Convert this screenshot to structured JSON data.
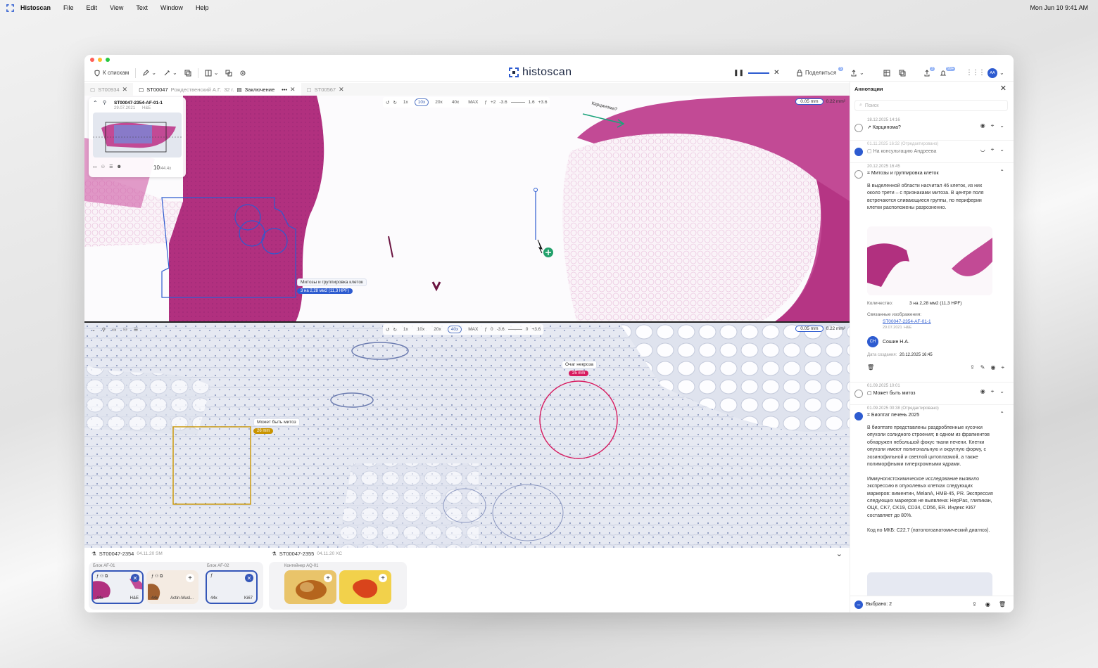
{
  "menubar": {
    "app": "Histoscan",
    "items": [
      "File",
      "Edit",
      "View",
      "Text",
      "Window",
      "Help"
    ],
    "clock": "Mon Jun 10  9:41 AM"
  },
  "toolbar": {
    "back_label": "К спискам",
    "brand": "histoscan",
    "share_label": "Поделиться",
    "share_badge": "5",
    "upload_badge": "3",
    "notif_badge": "99+",
    "avatar": "АА"
  },
  "tabs": [
    {
      "label": "ST00934"
    },
    {
      "label": "ST00047",
      "sub": "Рождественский А.Г.",
      "age": "32 г.",
      "extra": "Заключение"
    },
    {
      "label": "ST00567"
    }
  ],
  "viewer": {
    "zoom_levels": [
      "1x",
      "10x",
      "20x",
      "40x",
      "MAX"
    ],
    "top_selected": "10x",
    "bottom_selected": "40x",
    "top_vals": [
      "+2",
      "-3.6",
      "1.6",
      "+3.6"
    ],
    "bottom_vals": [
      "0",
      "-3.6",
      "0",
      "+3.6"
    ],
    "scale_len": "0.05 mm",
    "scale_area": "0.22 mm²"
  },
  "minimap": {
    "title": "ST00047-2354-AF-01-1",
    "date": "29.07.2021",
    "stain": "H&E",
    "zoom": "10",
    "zoom_max": "/44.4x"
  },
  "annotations_on_slide": {
    "mitosis_label": "Митозы и группировка клеток",
    "mitosis_pill": "3 на 2,28 мм2 (11,3 HPF)",
    "carcinoma_label": "Карцинома?",
    "necrosis_label": "Очаг некроза",
    "necrosis_pill": "25 mm",
    "mitoz_label": "Может быть митоз",
    "mitoz_pill": "26 mm"
  },
  "bottombar": {
    "case1": "ST00047-2354",
    "case1_meta": "04.11.20  SM",
    "case2": "ST00047-2355",
    "case2_meta": "04.11.20  XC",
    "block1": "Блок AF-01",
    "block2": "Блок AF-02",
    "container": "Контейнер AQ-01",
    "thumbs": [
      {
        "tl": "44x",
        "tr": "H&E"
      },
      {
        "tl": "44x",
        "tr": "Actin-Musl..."
      },
      {
        "tl": "44x",
        "tr": "Ki67"
      }
    ]
  },
  "panel": {
    "title": "Аннотации",
    "search_placeholder": "Поиск",
    "items": [
      {
        "date": "18.12.2025 14:16",
        "title": "Карцинома?"
      },
      {
        "date": "01.11.2025 16:32 (Отредактировано)",
        "title": "На консультацию Андреева"
      },
      {
        "date": "20.12.2025 16:45",
        "title": "Митозы и группировка клеток",
        "body": "В выделенной области насчитал 46 клеток, из них около трети – с признаками митоза. В центре поля встречаются сливающиеся группы, по периферии клетки расположены разрозненно.",
        "count_label": "Количество:",
        "count_value": "3 на 2,28 мм2 (11,3 HPF)",
        "linked_label": "Связанные изображения:",
        "linked_link": "ST00047-2354-AF-01-1",
        "linked_date": "29.07.2021",
        "linked_stain": "H&E",
        "author_initials": "СН",
        "author": "Сошин Н.А.",
        "created_label": "Дата создания:",
        "created_value": "20.12.2025 16:45"
      },
      {
        "date": "01.09.2025 10:01",
        "title": "Может быть митоз"
      },
      {
        "date": "01.09.2025 00:38 (Отредактировано)",
        "title": "Биоптат печень 2025",
        "body": "В биоптате представлены раздробленные кусочки опухоли солидного строения; в одном из фрагментов обнаружен небольшой фокус ткани печени. Клетки опухоли имеют полигональную и округлую форму, с эозинофильной и светлой цитоплазмой, а также полиморфными гиперхромными ядрами.\n\nИммуногистохимическое исследование выявило экспрессию в опухолевых клетках следующих маркеров: виментин, MelanA, HMB-45, PR. Экспрессия следующих маркеров не выявлена: HepPas, глипикан, ОЦК, CK7, CK19, CD34, CD56, ER. Индекс Ki67 составляет до 80%.\n\nКод по МКБ: C22.7 (патологоанатомический диагноз)."
      }
    ],
    "footer": "Выбрано: 2"
  },
  "colors": {
    "accent": "#2d5bd0",
    "necrosis": "#d81b60",
    "mitoz": "#c99400",
    "he": "#b1307f"
  }
}
